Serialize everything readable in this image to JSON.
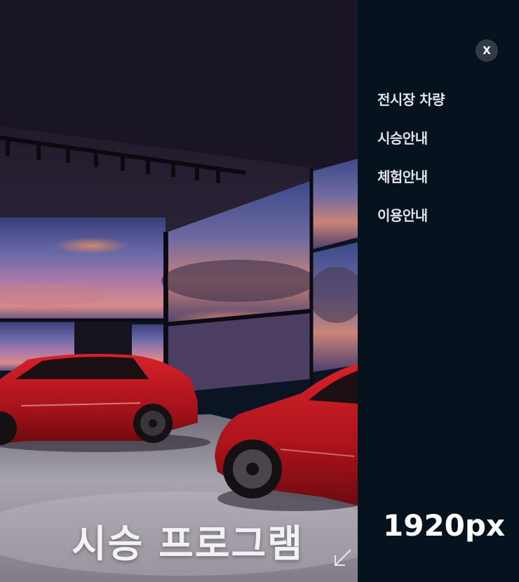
{
  "hero": {
    "title": "시승 프로그램",
    "arrow_icon": "arrow-down-left-icon"
  },
  "side_panel": {
    "close_label": "X",
    "menu_items": [
      {
        "label": "전시장 차량"
      },
      {
        "label": "시승안내"
      },
      {
        "label": "체험안내"
      },
      {
        "label": "이용안내"
      }
    ],
    "resolution_label": "1920px"
  },
  "colors": {
    "panel_background": "#07121f",
    "close_button": "#323b47",
    "menu_text": "#dfe3e8",
    "car_red": "#b8141c"
  }
}
